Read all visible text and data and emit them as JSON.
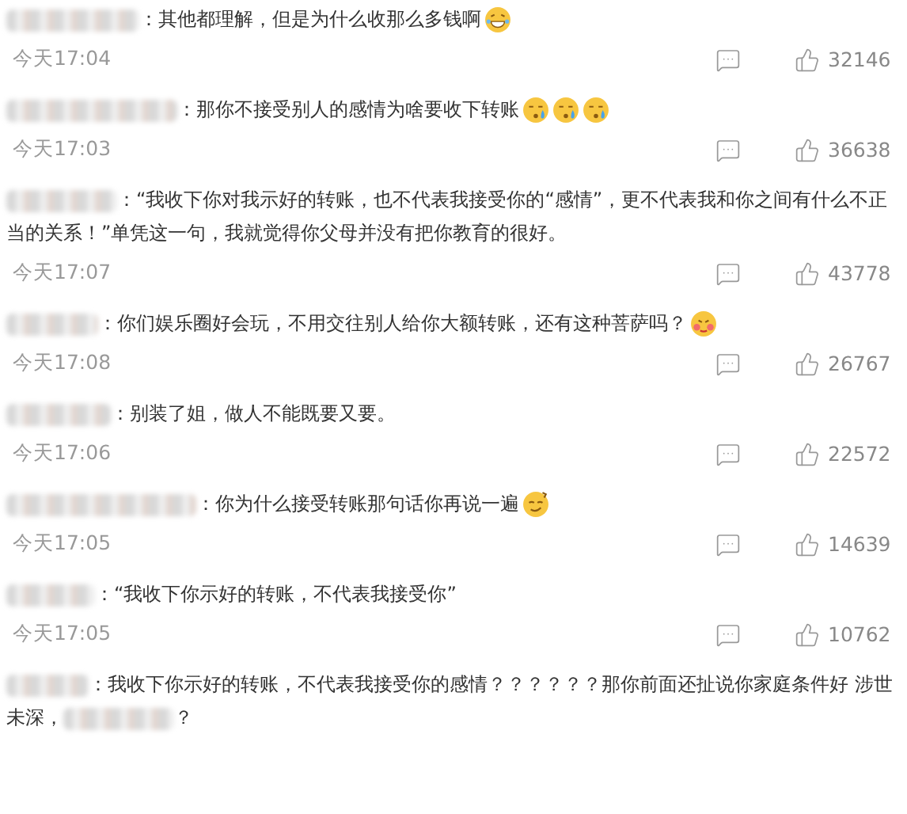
{
  "comments": [
    {
      "text": "：其他都理解，但是为什么收那么多钱啊",
      "emojis": [
        {
          "kind": "laughing"
        }
      ],
      "time": "今天17:04",
      "likes": "32146"
    },
    {
      "text": "：那你不接受别人的感情为啥要收下转账",
      "emojis": [
        {
          "kind": "crying"
        },
        {
          "kind": "crying"
        },
        {
          "kind": "crying"
        }
      ],
      "time": "今天17:03",
      "likes": "36638"
    },
    {
      "text": "：“我收下你对我示好的转账，也不代表我接受你的“感情”，更不代表我和你之间有什么不正当的关系！”单凭这一句，我就觉得你父母并没有把你教育的很好。",
      "time": "今天17:07",
      "likes": "43778"
    },
    {
      "text": "：你们娱乐圈好会玩，不用交往别人给你大额转账，还有这种菩萨吗？",
      "emojis": [
        {
          "kind": "blushing"
        }
      ],
      "time": "今天17:08",
      "likes": "26767"
    },
    {
      "text": "：别装了姐，做人不能既要又要。",
      "time": "今天17:06",
      "likes": "22572"
    },
    {
      "text": "：你为什么接受转账那句话你再说一遍",
      "emojis": [
        {
          "kind": "smug"
        }
      ],
      "time": "今天17:05",
      "likes": "14639"
    },
    {
      "text": "：“我收下你示好的转账，不代表我接受你”",
      "time": "今天17:05",
      "likes": "10762"
    },
    {
      "text": "：我收下你示好的转账，不代表我接受你的感情？？？？？？那你前面还扯说你家庭条件好 涉世未深，",
      "text_end": "？"
    }
  ]
}
